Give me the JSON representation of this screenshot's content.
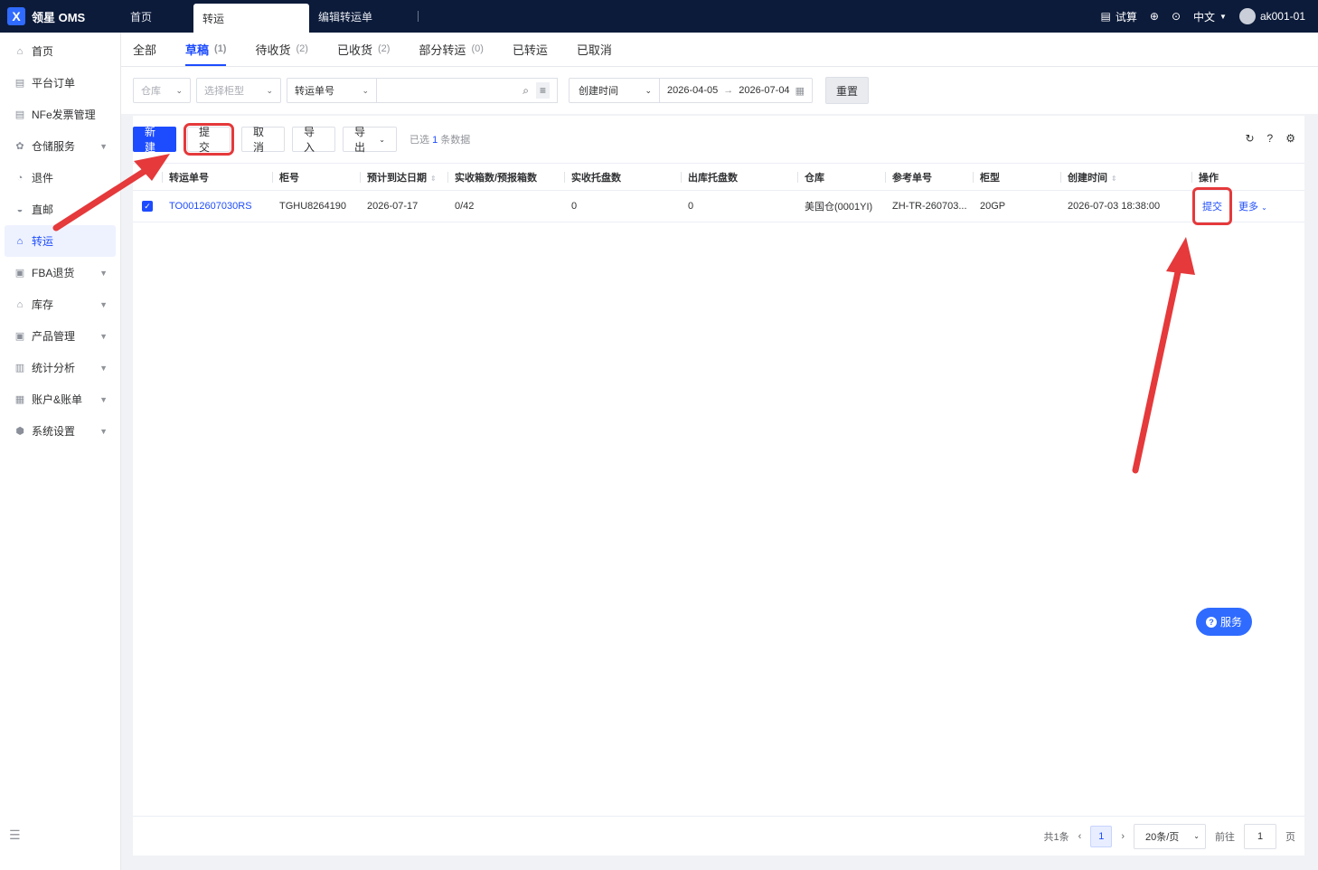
{
  "app": {
    "logo_text": "领星 OMS"
  },
  "top_tabs": [
    {
      "label": "首页"
    },
    {
      "label": "转运"
    },
    {
      "label": "编辑转运单"
    }
  ],
  "top_right": {
    "trial": "试算",
    "language": "中文",
    "user": "ak001-01"
  },
  "sidebar": {
    "items": [
      {
        "label": "首页",
        "icon": "home-icon"
      },
      {
        "label": "平台订单",
        "icon": "document-icon"
      },
      {
        "label": "NFe发票管理",
        "icon": "invoice-icon"
      },
      {
        "label": "仓储服务",
        "icon": "warehouse-icon"
      },
      {
        "label": "退件",
        "icon": "return-icon"
      },
      {
        "label": "直邮",
        "icon": "mail-icon"
      },
      {
        "label": "转运",
        "icon": "transfer-icon"
      },
      {
        "label": "FBA退货",
        "icon": "fba-icon"
      },
      {
        "label": "库存",
        "icon": "inventory-icon"
      },
      {
        "label": "产品管理",
        "icon": "product-icon"
      },
      {
        "label": "统计分析",
        "icon": "stats-icon"
      },
      {
        "label": "账户&账单",
        "icon": "account-icon"
      },
      {
        "label": "系统设置",
        "icon": "settings-icon"
      }
    ]
  },
  "status_tabs": [
    {
      "label": "全部",
      "count": ""
    },
    {
      "label": "草稿",
      "count": "(1)"
    },
    {
      "label": "待收货",
      "count": "(2)"
    },
    {
      "label": "已收货",
      "count": "(2)"
    },
    {
      "label": "部分转运",
      "count": "(0)"
    },
    {
      "label": "已转运",
      "count": ""
    },
    {
      "label": "已取消",
      "count": ""
    }
  ],
  "filters": {
    "warehouse_placeholder": "仓库",
    "box_type_placeholder": "选择柜型",
    "search_field": "转运单号",
    "date_field": "创建时间",
    "date_start": "2026-04-05",
    "date_end": "2026-07-04",
    "reset_label": "重置"
  },
  "toolbar": {
    "new_label": "新建",
    "submit_label": "提交",
    "cancel_label": "取消",
    "import_label": "导入",
    "export_label": "导出",
    "selected_prefix": "已选",
    "selected_count": "1",
    "selected_suffix": "条数据"
  },
  "table": {
    "columns": [
      "转运单号",
      "柜号",
      "预计到达日期",
      "实收箱数/预报箱数",
      "实收托盘数",
      "出库托盘数",
      "仓库",
      "参考单号",
      "柜型",
      "创建时间",
      "操作"
    ],
    "rows": [
      {
        "no": "TO0012607030RS",
        "container": "TGHU8264190",
        "eta": "2026-07-17",
        "boxes": "0/42",
        "recv_pallets": "0",
        "out_pallets": "0",
        "warehouse": "美国仓(0001YI)",
        "ref": "ZH-TR-260703...",
        "type": "20GP",
        "created": "2026-07-03 18:38:00",
        "op_submit": "提交",
        "op_more": "更多"
      }
    ]
  },
  "pager": {
    "total": "共1条",
    "current_page": "1",
    "page_size": "20条/页",
    "goto_label": "前往",
    "goto_value": "1",
    "page_unit": "页"
  },
  "service_button": "服务",
  "colors": {
    "primary": "#1d4cff",
    "topbar": "#0c1b3a",
    "annotation": "#e5393b"
  }
}
